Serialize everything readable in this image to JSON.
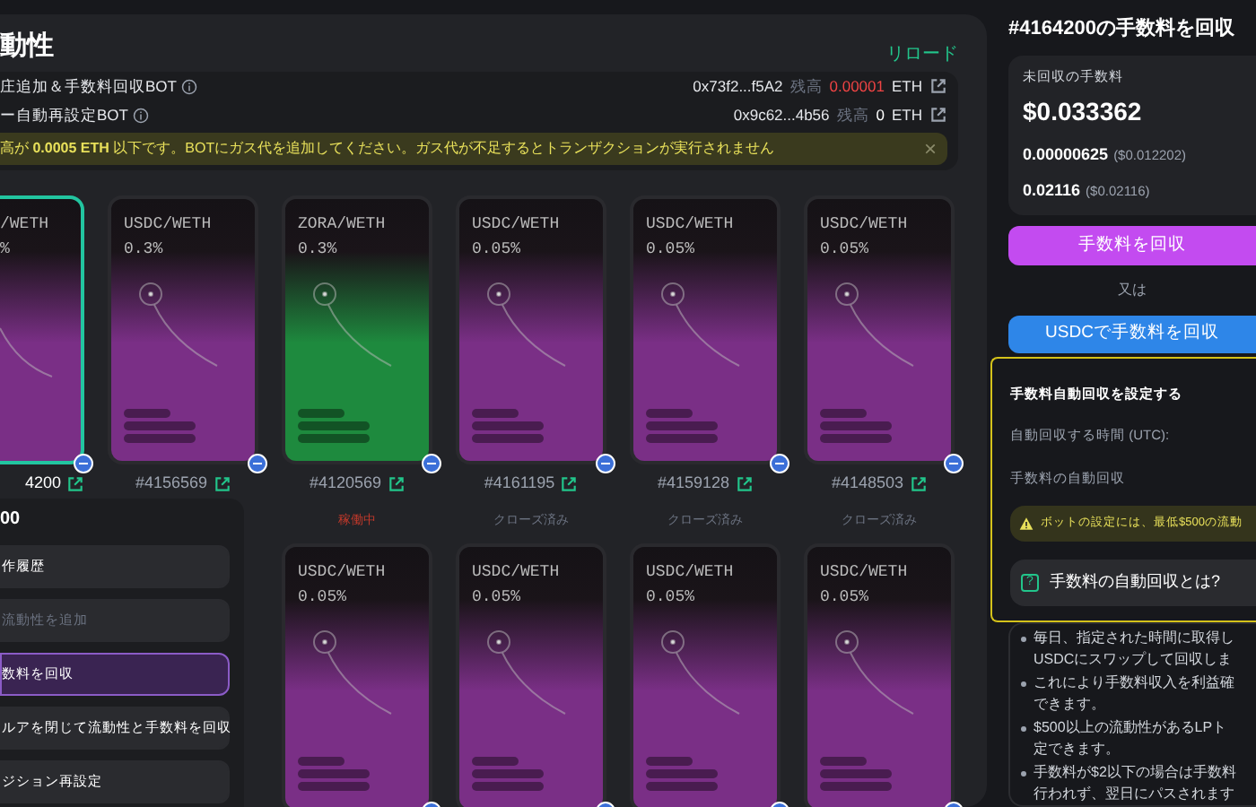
{
  "panel": {
    "title": "動性",
    "reload": "リロード"
  },
  "bots": [
    {
      "label": "庄追加＆手数料回収BOT",
      "address": "0x73f2...f5A2",
      "balance_label": "残高",
      "balance": "0.00001",
      "unit": "ETH",
      "low": true
    },
    {
      "label": "ー自動再設定BOT",
      "address": "0x9c62...4b56",
      "balance_label": "残高",
      "balance": "0",
      "unit": "ETH",
      "low": false
    }
  ],
  "warning": {
    "text": "高が **0.0005 ETH** 以下です。BOTにガス代を追加してください。ガス代が不足するとトランザクションが実行されません",
    "close": "×"
  },
  "positions": [
    {
      "kind": "cut",
      "pair": "/WETH",
      "fee": "%",
      "color": "#7a2f86",
      "selected": true,
      "token_id": "4200"
    },
    {
      "kind": "full",
      "pair": "USDC/WETH",
      "fee": "0.3%",
      "color": "#7a2f86",
      "selected": false,
      "token_id": "#4156569"
    },
    {
      "kind": "full",
      "pair": "ZORA/WETH",
      "fee": "0.3%",
      "color": "#1e8a3e",
      "selected": false,
      "token_id": "#4120569",
      "status": {
        "text": "稼働中",
        "color": "#c0392b"
      }
    },
    {
      "kind": "full",
      "pair": "USDC/WETH",
      "fee": "0.05%",
      "color": "#7a2f86",
      "selected": false,
      "token_id": "#4161195",
      "status": {
        "text": "クローズ済み",
        "color": "#6b7280"
      }
    },
    {
      "kind": "full",
      "pair": "USDC/WETH",
      "fee": "0.05%",
      "color": "#7a2f86",
      "selected": false,
      "token_id": "#4159128",
      "status": {
        "text": "クローズ済み",
        "color": "#6b7280"
      }
    },
    {
      "kind": "full",
      "pair": "USDC/WETH",
      "fee": "0.05%",
      "color": "#7a2f86",
      "selected": false,
      "token_id": "#4148503",
      "status": {
        "text": "クローズ済み",
        "color": "#6b7280"
      }
    }
  ],
  "more_positions": [
    {
      "pair": "USDC/WETH",
      "fee": "0.05%",
      "color": "#7a2f86",
      "selected": false
    },
    {
      "pair": "USDC/WETH",
      "fee": "0.05%",
      "color": "#7a2f86",
      "selected": false
    },
    {
      "pair": "USDC/WETH",
      "fee": "0.05%",
      "color": "#7a2f86",
      "selected": false
    },
    {
      "pair": "USDC/WETH",
      "fee": "0.05%",
      "color": "#7a2f86",
      "selected": false
    }
  ],
  "menu": {
    "title": "00",
    "items": [
      {
        "label": "作履歴",
        "disabled": false,
        "selected": false
      },
      {
        "label": "流動性を追加",
        "disabled": true,
        "selected": false
      },
      {
        "label": "数料を回収",
        "disabled": false,
        "selected": true
      },
      {
        "label": "ルアを閉じて流動性と手数料を回収",
        "disabled": false,
        "selected": false
      },
      {
        "label": "ジション再設定",
        "disabled": false,
        "selected": false
      }
    ]
  },
  "collect": {
    "title": "#4164200の手数料を回収",
    "unclaimed_label": "未回収の手数料",
    "total": "$0.033362",
    "amounts": [
      {
        "amount": "0.00000625",
        "usd": "($0.012202)"
      },
      {
        "amount": "0.02116",
        "usd": "($0.02116)"
      }
    ],
    "collect_button": "手数料を回収",
    "or": "又は",
    "usdc_button": "USDCで手数料を回収"
  },
  "auto": {
    "title": "手数料自動回収を設定する",
    "time_label": "自動回収する時間 (UTC):",
    "toggle_label": "手数料の自動回収",
    "warning": "ボットの設定には、最低$500の流動",
    "faq_icon": "?",
    "faq": "手数料の自動回収とは?",
    "bullets": [
      [
        "毎日、指定された時間に取得し",
        "USDCにスワップして回収しま"
      ],
      [
        "これにより手数料収入を利益確",
        "できます。"
      ],
      [
        "$500以上の流動性があるLPト",
        "定できます。"
      ],
      [
        "手数料が$2以下の場合は手数料",
        "行われず、翌日にパスされます"
      ]
    ]
  }
}
